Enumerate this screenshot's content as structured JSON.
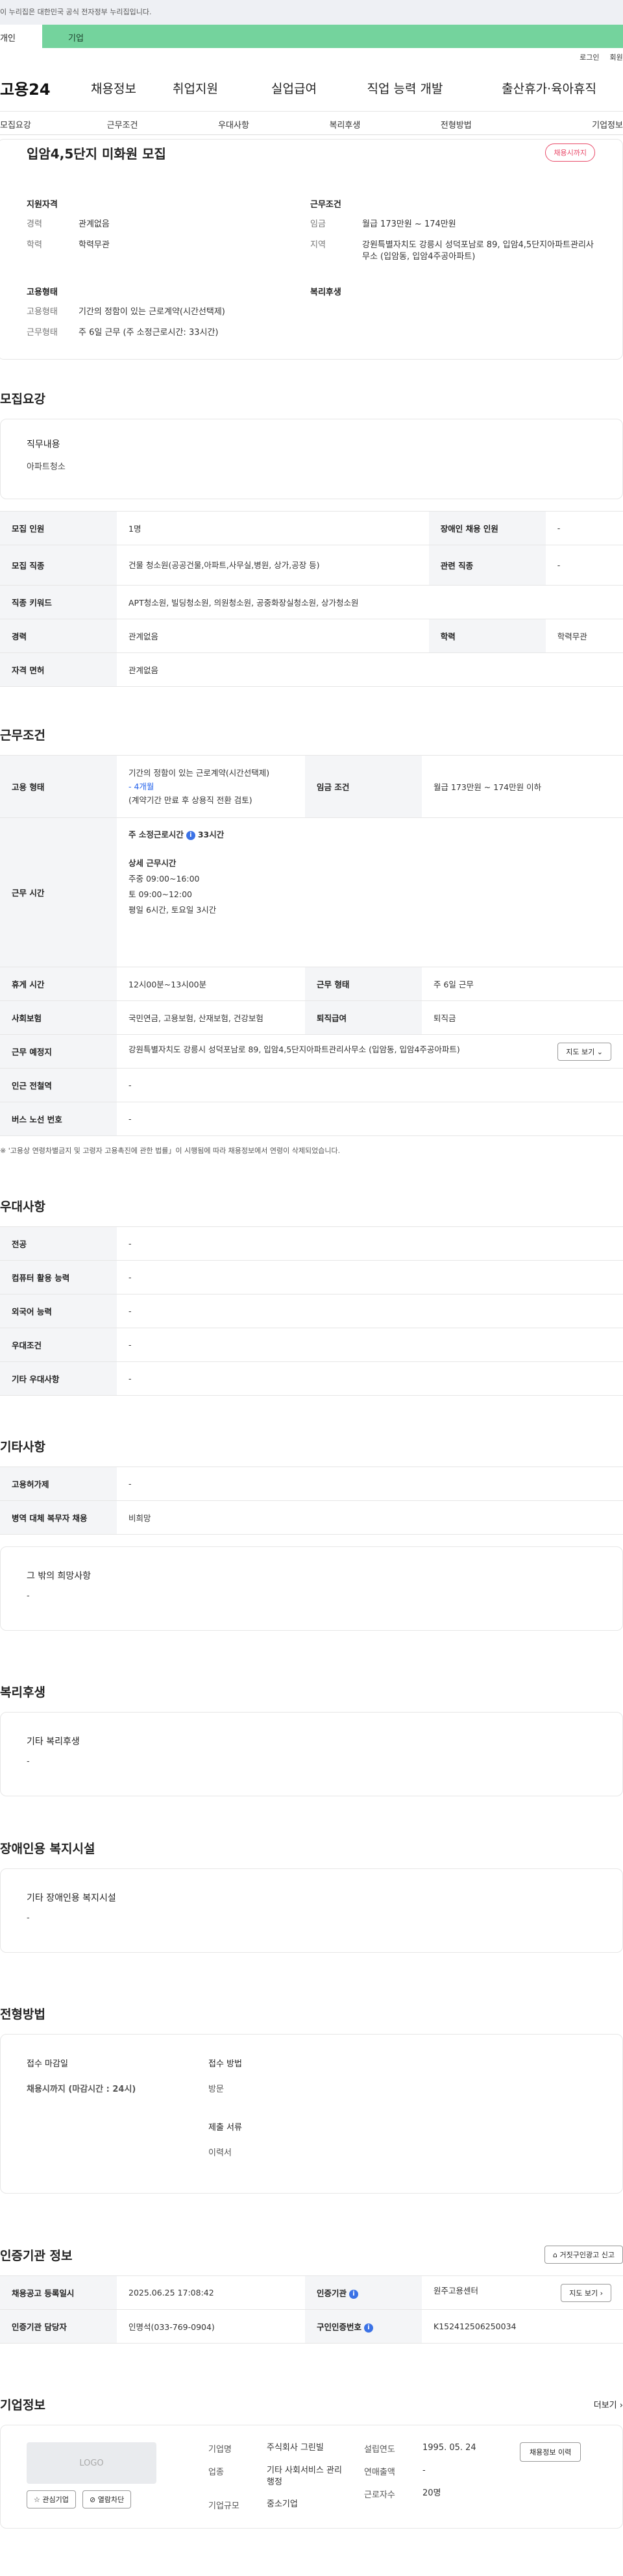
{
  "gov_bar": "이 누리집은 대한민국 공식 전자정부 누리집입니다.",
  "top_tabs": [
    "개인",
    "기업"
  ],
  "util_links": [
    "로그인",
    "회원가입"
  ],
  "gnb": {
    "logo": "고용24",
    "menus": [
      "채용정보",
      "취업지원",
      "실업급여",
      "직업 능력 개발",
      "출산휴가·육아휴직"
    ]
  },
  "subtabs": [
    "모집요강",
    "근무조건",
    "우대사항",
    "복리후생",
    "전형방법",
    "기업정보"
  ],
  "hero": {
    "title": "입암4,5단지 미화원 모집",
    "deadline_badge": "채용시까지",
    "qual_title": "지원자격",
    "qual": [
      {
        "k": "경력",
        "v": "관계없음"
      },
      {
        "k": "학력",
        "v": "학력무관"
      }
    ],
    "cond_title": "근무조건",
    "cond": [
      {
        "k": "임금",
        "v": "월급 173만원 ~ 174만원"
      },
      {
        "k": "지역",
        "v": "강원특별자치도 강릉시 성덕포남로 89, 입암4,5단지아파트관리사무소 (입암동, 입암4주공아파트)"
      }
    ],
    "emp_title": "고용형태",
    "emp": [
      {
        "k": "고용형태",
        "v": "기간의 정함이 있는 근로계약(시간선택제)"
      },
      {
        "k": "근무형태",
        "v": "주 6일 근무 (주 소정근로시간: 33시간)"
      }
    ],
    "welfare_title": "복리후생"
  },
  "recruit": {
    "title": "모집요강",
    "job_label": "직무내용",
    "job_value": "아파트청소",
    "rows": [
      [
        "모집 인원",
        "1명",
        "장애인 채용 인원",
        "-"
      ],
      [
        "모집 직종",
        "건물 청소원(공공건물,아파트,사무실,병원, 상가,공장 등)",
        "관련 직종",
        "-"
      ],
      [
        "직종 키워드",
        "APT청소원, 빌딩청소원, 의원청소원, 공중화장실청소원, 상가청소원"
      ],
      [
        "경력",
        "관계없음",
        "학력",
        "학력무관"
      ],
      [
        "자격 면허",
        "관계없음"
      ]
    ]
  },
  "work": {
    "title": "근무조건",
    "emp_label": "고용 형태",
    "emp_line1": "기간의 정함이 있는 근로계약(시간선택제)",
    "emp_line2": "- 4개월",
    "emp_line3": "(계약기간 만료 후 상용직 전환 검토)",
    "wage_label": "임금 조건",
    "wage_value": "월급 173만원 ~ 174만원 이하",
    "time_label": "근무 시간",
    "time_main": "주 소정근로시간",
    "time_hours": "33시간",
    "time_detail_title": "상세 근무시간",
    "time_lines": [
      "주중 09:00~16:00",
      "토 09:00~12:00",
      "평일 6시간,  토요일 3시간"
    ],
    "rows": [
      [
        "휴게 시간",
        "12시00분~13시00분",
        "근무 형태",
        "주 6일 근무"
      ],
      [
        "사회보험",
        "국민연금, 고용보험, 산재보험, 건강보험",
        "퇴직급여",
        "퇴직금"
      ]
    ],
    "place_label": "근무 예정지",
    "place_value": "강원특별자치도 강릉시 성덕포남로 89, 입암4,5단지아파트관리사무소 (입암동, 입암4주공아파트)",
    "map_btn": "지도 보기",
    "station_label": "인근 전철역",
    "station_value": "-",
    "bus_label": "버스 노선 번호",
    "bus_value": "-",
    "note": "※ '고용상 연령차별금지 및 고령자 고용촉진에 관한 법률」이 시행됨에 따라 채용정보에서 연령이 삭제되었습니다."
  },
  "pref": {
    "title": "우대사항",
    "rows": [
      [
        "전공",
        "-"
      ],
      [
        "컴퓨터 활용 능력",
        "-"
      ],
      [
        "외국어 능력",
        "-"
      ],
      [
        "우대조건",
        "-"
      ],
      [
        "기타 우대사항",
        "-"
      ]
    ]
  },
  "etc": {
    "title": "기타사항",
    "rows": [
      [
        "고용허가제",
        "-"
      ],
      [
        "병역 대체 복무자 채용",
        "비희망"
      ]
    ],
    "box_title": "그 밖의 희망사항",
    "box_value": "-"
  },
  "welfare": {
    "title": "복리후생",
    "box_title": "기타 복리후생",
    "box_value": "-"
  },
  "disability": {
    "title": "장애인용 복지시설",
    "box_title": "기타 장애인용 복지시설",
    "box_value": "-"
  },
  "apply": {
    "title": "전형방법",
    "deadline_label": "접수 마감일",
    "deadline_value": "채용시까지 (마감시간 : 24시)",
    "method_label": "접수 방법",
    "method_value": "방문",
    "doc_label": "제출 서류",
    "doc_value": "이력서"
  },
  "agency": {
    "title": "인증기관 정보",
    "report_btn": "거짓구인광고 신고",
    "rows": [
      [
        "채용공고 등록일시",
        "2025.06.25 17:08:42",
        "인증기관",
        "원주고용센터"
      ],
      [
        "인증기관 담당자",
        "인명석(033-769-0904)",
        "구인인증번호",
        "K152412506250034"
      ]
    ],
    "map_btn": "지도 보기"
  },
  "company": {
    "title": "기업정보",
    "more": "더보기",
    "logo": "LOGO",
    "fav_btn": "관심기업",
    "block_btn": "열람차단",
    "k_name": "기업명",
    "v_name": "주식회사 그린빌",
    "k_type": "업종",
    "v_type": "기타 사회서비스 관리 행정",
    "k_size": "기업규모",
    "v_size": "중소기업",
    "k_year": "설립연도",
    "v_year": "1995. 05. 24",
    "k_sales": "연매출액",
    "v_sales": "-",
    "k_emp": "근로자수",
    "v_emp": "20명",
    "history_btn": "채용정보 이력"
  }
}
